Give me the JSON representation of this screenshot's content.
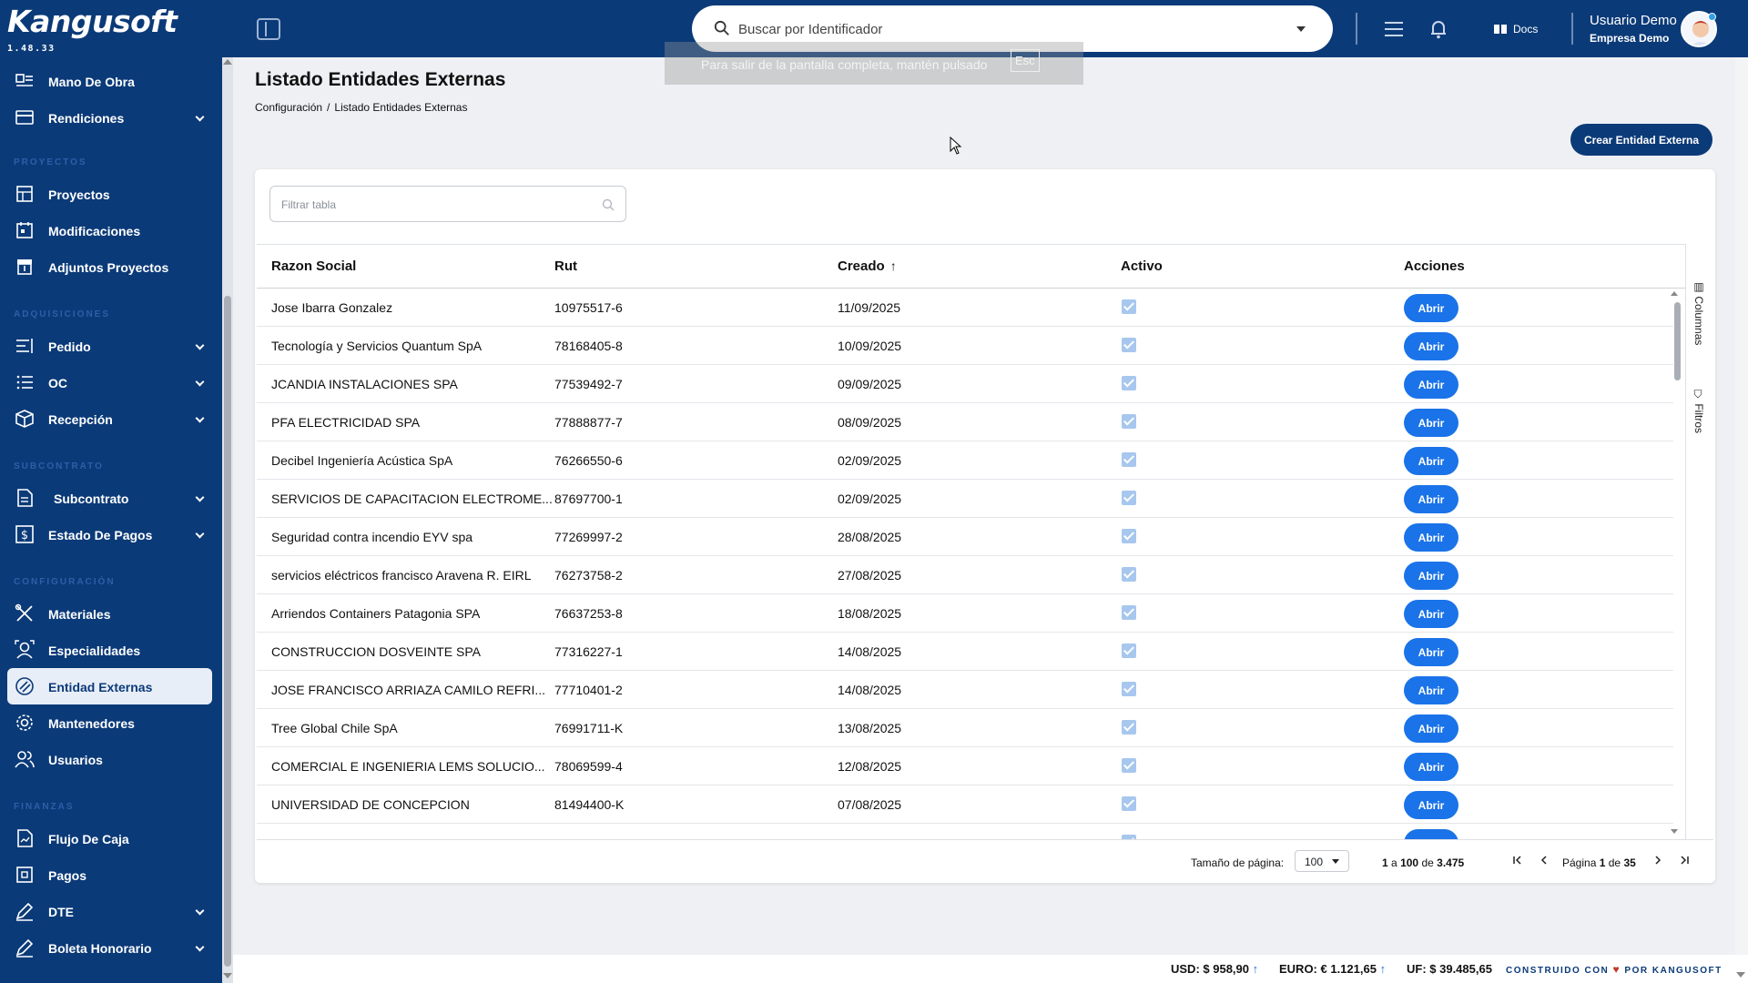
{
  "app": {
    "logo": "Kangusoft",
    "version": "1.48.33"
  },
  "header": {
    "search_placeholder": "Buscar por Identificador",
    "docs_label": "Docs",
    "user_name": "Usuario Demo",
    "user_company": "Empresa Demo"
  },
  "fullscreen_toast": {
    "text": "Para salir de la pantalla completa, mantén pulsado",
    "key": "Esc"
  },
  "sidebar": {
    "items_top": [
      {
        "label": "Mano De Obra",
        "icon": "workers-icon"
      },
      {
        "label": "Rendiciones",
        "icon": "card-icon",
        "expandable": true
      }
    ],
    "sections": [
      {
        "title": "PROYECTOS",
        "items": [
          {
            "label": "Proyectos",
            "icon": "project-icon"
          },
          {
            "label": "Modificaciones",
            "icon": "calendar-icon"
          },
          {
            "label": "Adjuntos Proyectos",
            "icon": "archive-icon"
          }
        ]
      },
      {
        "title": "ADQUISICIONES",
        "items": [
          {
            "label": "Pedido",
            "icon": "list-icon",
            "expandable": true
          },
          {
            "label": "OC",
            "icon": "checklist-icon",
            "expandable": true
          },
          {
            "label": "Recepción",
            "icon": "box-icon",
            "expandable": true
          }
        ]
      },
      {
        "title": "SUBCONTRATO",
        "items": [
          {
            "label": "Subcontrato",
            "icon": "document-icon",
            "expandable": true
          },
          {
            "label": "Estado De Pagos",
            "icon": "dollar-icon",
            "expandable": true
          }
        ]
      },
      {
        "title": "CONFIGURACIÓN",
        "items": [
          {
            "label": "Materiales",
            "icon": "tools-icon"
          },
          {
            "label": "Especialidades",
            "icon": "person-icon"
          },
          {
            "label": "Entidad Externas",
            "icon": "link-icon",
            "active": true
          },
          {
            "label": "Mantenedores",
            "icon": "gear-icon"
          },
          {
            "label": "Usuarios",
            "icon": "users-icon"
          }
        ]
      },
      {
        "title": "FINANZAS",
        "items": [
          {
            "label": "Flujo De Caja",
            "icon": "cashflow-icon"
          },
          {
            "label": "Pagos",
            "icon": "payment-icon"
          },
          {
            "label": "DTE",
            "icon": "pen-icon",
            "expandable": true
          },
          {
            "label": "Boleta Honorario",
            "icon": "pen-icon",
            "expandable": true
          }
        ]
      }
    ]
  },
  "page": {
    "title": "Listado Entidades Externas",
    "breadcrumb": [
      "Configuración",
      "/",
      "Listado Entidades Externas"
    ],
    "create_button": "Crear Entidad Externa",
    "filter_placeholder": "Filtrar tabla"
  },
  "table": {
    "columns": [
      "Razon Social",
      "Rut",
      "Creado",
      "Activo",
      "Acciones"
    ],
    "sort_indicator": "↑",
    "action_label": "Abrir",
    "rows": [
      {
        "razon": "Jose Ibarra Gonzalez",
        "rut": "10975517-6",
        "creado": "11/09/2025"
      },
      {
        "razon": "Tecnología y Servicios Quantum SpA",
        "rut": "78168405-8",
        "creado": "10/09/2025"
      },
      {
        "razon": "JCANDIA INSTALACIONES SPA",
        "rut": "77539492-7",
        "creado": "09/09/2025"
      },
      {
        "razon": "PFA ELECTRICIDAD SPA",
        "rut": "77888877-7",
        "creado": "08/09/2025"
      },
      {
        "razon": "Decibel Ingeniería Acústica SpA",
        "rut": "76266550-6",
        "creado": "02/09/2025"
      },
      {
        "razon": "SERVICIOS DE CAPACITACION ELECTROME...",
        "rut": "87697700-1",
        "creado": "02/09/2025"
      },
      {
        "razon": "Seguridad contra incendio EYV spa",
        "rut": "77269997-2",
        "creado": "28/08/2025"
      },
      {
        "razon": "servicios eléctricos francisco Aravena R. EIRL",
        "rut": "76273758-2",
        "creado": "27/08/2025"
      },
      {
        "razon": "Arriendos Containers Patagonia SPA",
        "rut": "76637253-8",
        "creado": "18/08/2025"
      },
      {
        "razon": "CONSTRUCCION DOSVEINTE SPA",
        "rut": "77316227-1",
        "creado": "14/08/2025"
      },
      {
        "razon": "JOSE FRANCISCO ARRIAZA CAMILO REFRI...",
        "rut": "77710401-2",
        "creado": "14/08/2025"
      },
      {
        "razon": "Tree Global Chile SpA",
        "rut": "76991711-K",
        "creado": "13/08/2025"
      },
      {
        "razon": "COMERCIAL E INGENIERIA LEMS SOLUCIO...",
        "rut": "78069599-4",
        "creado": "12/08/2025"
      },
      {
        "razon": "UNIVERSIDAD DE CONCEPCION",
        "rut": "81494400-K",
        "creado": "07/08/2025"
      }
    ],
    "side_tabs": [
      "Columnas",
      "Filtros"
    ]
  },
  "pagination": {
    "page_size_label": "Tamaño de página:",
    "page_size": "100",
    "range_prefix": "1",
    "range_a": "a",
    "range_end": "100",
    "range_de": "de",
    "total": "3.475",
    "page_label": "Página",
    "page_current": "1",
    "page_de": "de",
    "page_total": "35"
  },
  "footer": {
    "usd": "USD: $ 958,90",
    "euro": "EURO: € 1.121,65",
    "uf": "UF: $ 39.485,65",
    "built_prefix": "CONSTRUIDO CON",
    "built_suffix": "POR KANGUSOFT"
  },
  "colors": {
    "brand": "#0b3a78",
    "action": "#1a73e8"
  }
}
